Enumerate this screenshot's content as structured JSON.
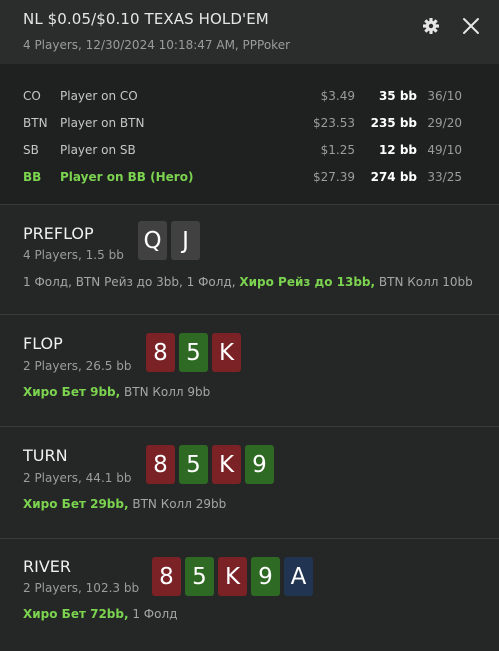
{
  "header": {
    "title": "NL $0.05/$0.10 TEXAS HOLD'EM",
    "subtitle": "4 Players, 12/30/2024 10:18:47 AM, PPPoker",
    "icons": [
      "gear-icon",
      "close-icon"
    ]
  },
  "players": [
    {
      "pos": "CO",
      "name": "Player on CO",
      "money": "$3.49",
      "bb": "35 bb",
      "stat": "36/10",
      "hero": false
    },
    {
      "pos": "BTN",
      "name": "Player on BTN",
      "money": "$23.53",
      "bb": "235 bb",
      "stat": "29/20",
      "hero": false
    },
    {
      "pos": "SB",
      "name": "Player on SB",
      "money": "$1.25",
      "bb": "12 bb",
      "stat": "49/10",
      "hero": false
    },
    {
      "pos": "BB",
      "name": "Player on BB (Hero)",
      "money": "$27.39",
      "bb": "274 bb",
      "stat": "33/25",
      "hero": true
    }
  ],
  "streets": {
    "preflop": {
      "title": "PREFLOP",
      "sub": "4 Players, 1.5 bb",
      "cards": [
        {
          "rank": "Q",
          "color": "grey"
        },
        {
          "rank": "J",
          "color": "grey"
        }
      ],
      "actions": [
        {
          "text": "1 Фолд, BTN Рейз до 3bb, 1 Фолд, ",
          "hero": false
        },
        {
          "text": "Хиро Рейз до 13bb,",
          "hero": true
        },
        {
          "text": " BTN Колл 10bb",
          "hero": false
        }
      ]
    },
    "flop": {
      "title": "FLOP",
      "sub": "2 Players, 26.5 bb",
      "cards": [
        {
          "rank": "8",
          "color": "red"
        },
        {
          "rank": "5",
          "color": "green"
        },
        {
          "rank": "K",
          "color": "red"
        }
      ],
      "actions": [
        {
          "text": "Хиро Бет 9bb,",
          "hero": true
        },
        {
          "text": " BTN Колл 9bb",
          "hero": false
        }
      ]
    },
    "turn": {
      "title": "TURN",
      "sub": "2 Players, 44.1 bb",
      "cards": [
        {
          "rank": "8",
          "color": "red"
        },
        {
          "rank": "5",
          "color": "green"
        },
        {
          "rank": "K",
          "color": "red"
        },
        {
          "rank": "9",
          "color": "green"
        }
      ],
      "actions": [
        {
          "text": "Хиро Бет 29bb,",
          "hero": true
        },
        {
          "text": " BTN Колл 29bb",
          "hero": false
        }
      ]
    },
    "river": {
      "title": "RIVER",
      "sub": "2 Players, 102.3 bb",
      "cards": [
        {
          "rank": "8",
          "color": "red"
        },
        {
          "rank": "5",
          "color": "green"
        },
        {
          "rank": "K",
          "color": "red"
        },
        {
          "rank": "9",
          "color": "green"
        },
        {
          "rank": "A",
          "color": "blue"
        }
      ],
      "actions": [
        {
          "text": "Хиро Бет 72bb,",
          "hero": true
        },
        {
          "text": " 1 Фолд",
          "hero": false
        }
      ]
    }
  },
  "colors": {
    "hero_green": "#7bd34f",
    "card_red": "#7a2226",
    "card_green": "#2f6a24",
    "card_blue": "#213552",
    "card_grey": "#414141"
  }
}
